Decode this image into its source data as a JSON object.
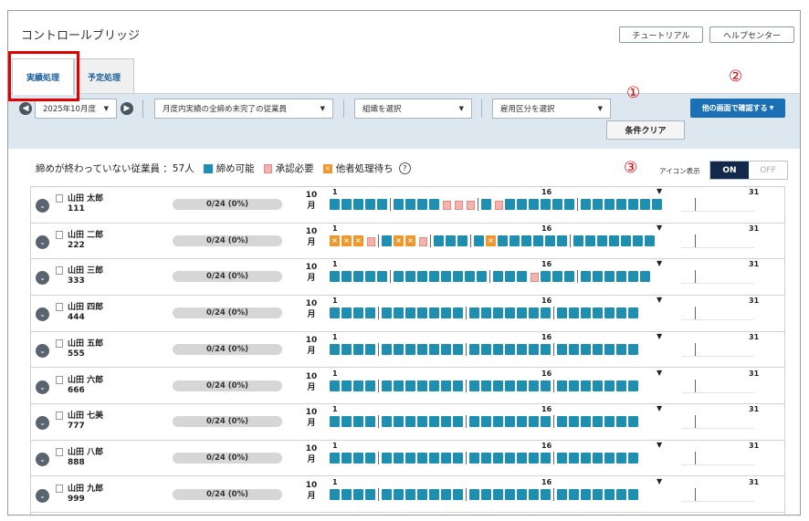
{
  "header": {
    "title": "コントロールブリッジ",
    "tutorial_label": "チュートリアル",
    "help_label": "ヘルプセンター"
  },
  "tabs": [
    {
      "label": "実績処理",
      "active": true
    },
    {
      "label": "予定処理",
      "active": false
    }
  ],
  "filters": {
    "month": "2025年10月度",
    "employee_filter": "月度内実績の全締め未完了の従業員",
    "organization": "組織を選択",
    "employment": "雇用区分を選択",
    "clear_label": "条件クリア",
    "other_screen_label": "他の画面で確認する"
  },
  "annotations": {
    "one": "①",
    "two": "②",
    "three": "③"
  },
  "summary": {
    "text": "締めが終わっていない従業員 ：57人",
    "legend_closable": "締め可能",
    "legend_approval": "承認必要",
    "legend_waiting": "他者処理待ち",
    "help_icon": "?"
  },
  "icon_display": {
    "label": "アイコン表示",
    "on": "ON",
    "off": "OFF",
    "state": "ON"
  },
  "calendar_labels": {
    "month_num": "10",
    "month_unit": "月",
    "day_start": "1",
    "day_mid": "16",
    "day_end": "31",
    "today_marker": "▼"
  },
  "employees": [
    {
      "name": "山田 太郎",
      "id": "111",
      "progress": "0/24 (0%)",
      "days": "BBBBB|BBBBDDD|BDBBBBBB|BBBBBBB"
    },
    {
      "name": "山田 二郎",
      "id": "222",
      "progress": "0/24 (0%)",
      "days": "OOOD|BOOD|BBB|BOBBBBBB|BBBBBBB"
    },
    {
      "name": "山田 三郎",
      "id": "333",
      "progress": "0/24 (0%)",
      "days": "BBBBB|BBBBBBBB|BBBDBBB|BBBBBB"
    },
    {
      "name": "山田 四郎",
      "id": "444",
      "progress": "0/24 (0%)",
      "days": "BBBB|BBBBBBB|BBBBBBB|BBBBBBB"
    },
    {
      "name": "山田 五郎",
      "id": "555",
      "progress": "0/24 (0%)",
      "days": "BBBB|BBBBBBB|BBBBBBB|BBBBBBB"
    },
    {
      "name": "山田 六郎",
      "id": "666",
      "progress": "0/24 (0%)",
      "days": "BBBB|BBBBBBB|BBBBBBB|BBBBBBB"
    },
    {
      "name": "山田 七美",
      "id": "777",
      "progress": "0/24 (0%)",
      "days": "BBBB|BBBBBBB|BBBBBBB|BBBBBBB"
    },
    {
      "name": "山田 八郎",
      "id": "888",
      "progress": "0/24 (0%)",
      "days": "BBBB|BBBBBBB|BBBBBBB|BBBBBBB"
    },
    {
      "name": "山田 九郎",
      "id": "999",
      "progress": "0/24 (0%)",
      "days": "BBBB|BBBBBBB|BBBBBBB|BBBBBBB"
    }
  ],
  "colors": {
    "closable": "#1e8fb0",
    "waiting": "#f0962a",
    "approval": "#f4b3ae",
    "highlight": "#e00000"
  }
}
